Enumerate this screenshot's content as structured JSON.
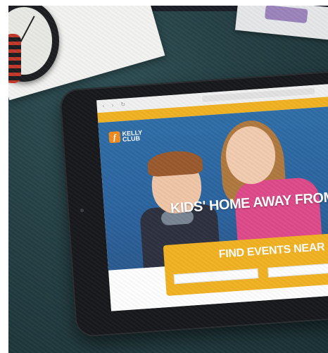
{
  "website": {
    "browser_nav": "‹ › ↻",
    "url": "",
    "logo_mark": "f",
    "logo_text": "KELLY CLUB",
    "menu": [
      "",
      ""
    ],
    "hero_title": "KIDS' HOME AWAY FROM",
    "hero_subtitle": "",
    "find_title": "FIND EVENTS NEAR",
    "field1_label": "",
    "field1_placeholder": "",
    "field2_label": "",
    "field2_placeholder": ""
  },
  "colors": {
    "accent_yellow": "#f2b323",
    "hero_blue": "#2f6ea8",
    "logo_orange": "#f28c1e",
    "desk": "#243f44"
  }
}
